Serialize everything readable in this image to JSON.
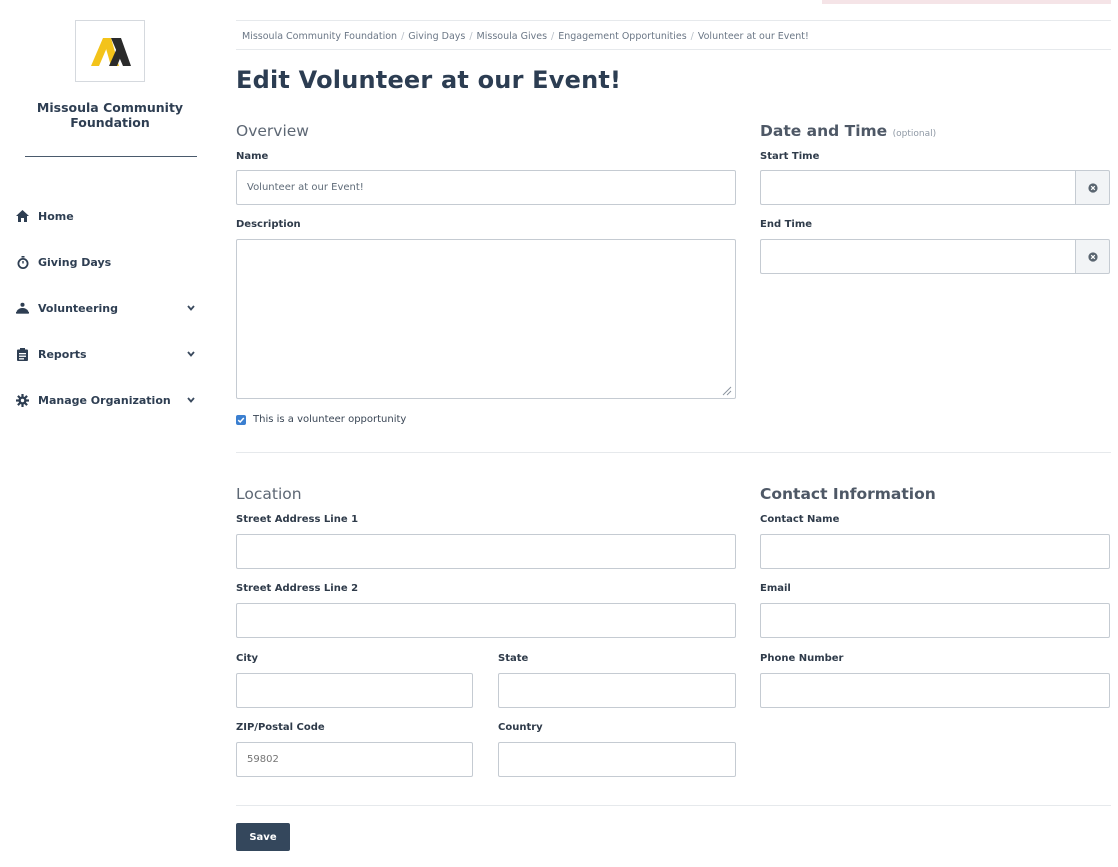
{
  "sidebar": {
    "org_name": "Missoula Community Foundation",
    "items": [
      {
        "label": "Home",
        "icon": "home-icon",
        "has_chevron": false
      },
      {
        "label": "Giving Days",
        "icon": "stopwatch-icon",
        "has_chevron": false
      },
      {
        "label": "Volunteering",
        "icon": "volunteer-icon",
        "has_chevron": true
      },
      {
        "label": "Reports",
        "icon": "clipboard-icon",
        "has_chevron": true
      },
      {
        "label": "Manage Organization",
        "icon": "gear-icon",
        "has_chevron": true
      }
    ]
  },
  "breadcrumb": [
    "Missoula Community Foundation",
    "Giving Days",
    "Missoula Gives",
    "Engagement Opportunities",
    "Volunteer at our Event!"
  ],
  "page_title": "Edit Volunteer at our Event!",
  "overview": {
    "heading": "Overview",
    "name_label": "Name",
    "name_value": "Volunteer at our Event!",
    "description_label": "Description",
    "description_value": "",
    "volunteer_checkbox_label": "This is a volunteer opportunity",
    "volunteer_checked": true
  },
  "date_time": {
    "heading": "Date and Time",
    "optional_note": "(optional)",
    "start_label": "Start Time",
    "start_value": "",
    "end_label": "End Time",
    "end_value": ""
  },
  "location": {
    "heading": "Location",
    "street1_label": "Street Address Line 1",
    "street1_value": "",
    "street2_label": "Street Address Line 2",
    "street2_value": "",
    "city_label": "City",
    "city_value": "",
    "state_label": "State",
    "state_value": "",
    "zip_label": "ZIP/Postal Code",
    "zip_placeholder": "59802",
    "country_label": "Country",
    "country_value": ""
  },
  "contact": {
    "heading": "Contact Information",
    "name_label": "Contact Name",
    "name_value": "",
    "email_label": "Email",
    "email_value": "",
    "phone_label": "Phone Number",
    "phone_value": ""
  },
  "save_label": "Save",
  "colors": {
    "primary_dark": "#34475c",
    "logo_yellow": "#f3c31a",
    "logo_dark": "#2b2b2b",
    "checkbox_blue": "#3b7fd0",
    "accent_pink": "#f5e4e7"
  }
}
